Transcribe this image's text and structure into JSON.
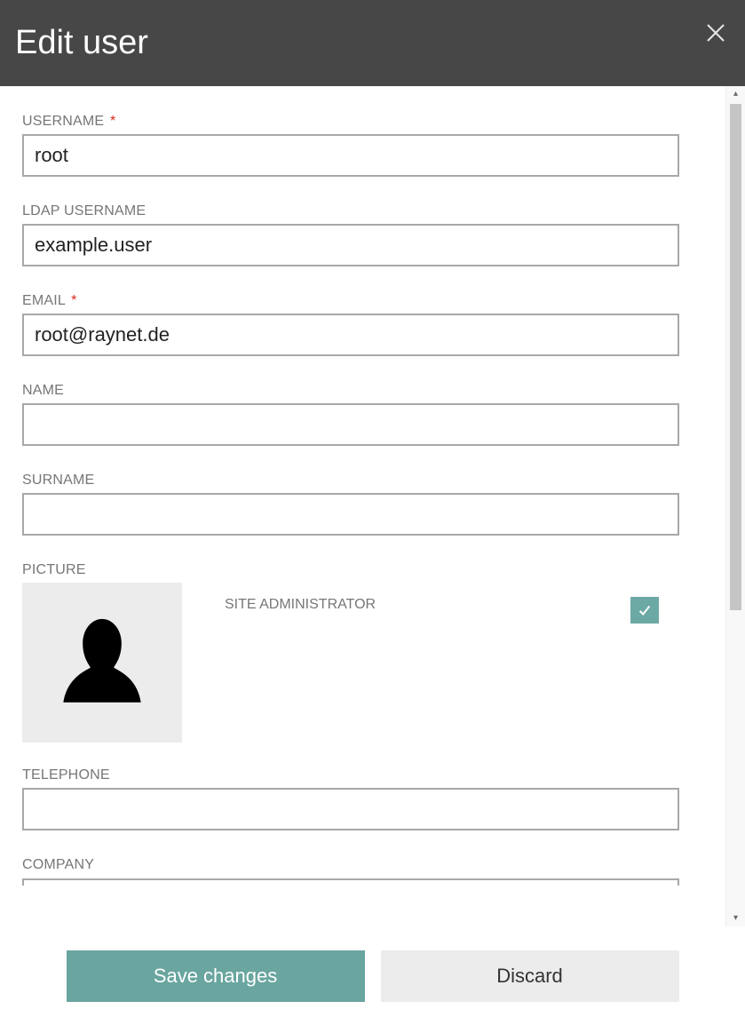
{
  "header": {
    "title": "Edit user"
  },
  "fields": {
    "username": {
      "label": "USERNAME",
      "required": true,
      "value": "root"
    },
    "ldap_username": {
      "label": "LDAP USERNAME",
      "required": false,
      "value": "example.user"
    },
    "email": {
      "label": "EMAIL",
      "required": true,
      "value": "root@raynet.de"
    },
    "name": {
      "label": "NAME",
      "required": false,
      "value": ""
    },
    "surname": {
      "label": "SURNAME",
      "required": false,
      "value": ""
    },
    "picture": {
      "label": "PICTURE"
    },
    "site_admin": {
      "label": "SITE ADMINISTRATOR",
      "checked": true
    },
    "telephone": {
      "label": "TELEPHONE",
      "required": false,
      "value": ""
    },
    "company": {
      "label": "COMPANY",
      "required": false,
      "value": ""
    }
  },
  "buttons": {
    "save": "Save changes",
    "discard": "Discard"
  },
  "required_marker": "*"
}
